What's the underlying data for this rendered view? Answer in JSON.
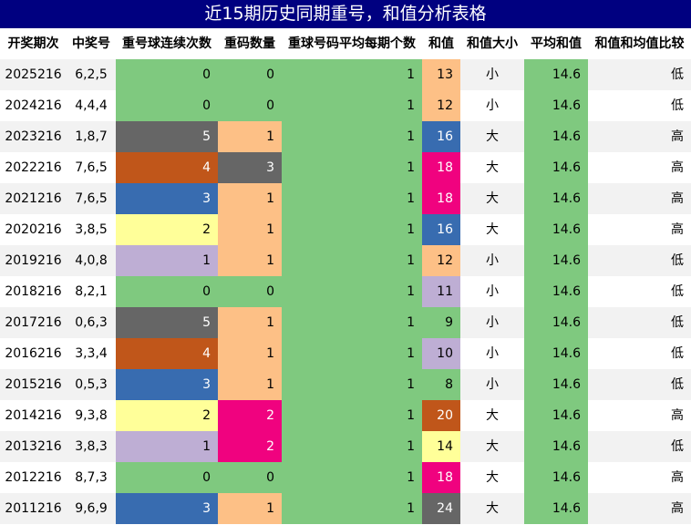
{
  "title": "近15期历史同期重号，和值分析表格",
  "headers": {
    "period": "开奖期次",
    "number": "中奖号",
    "consec": "重号球连续次数",
    "count": "重码数量",
    "avg": "重球号码平均每期个数",
    "sum": "和值",
    "size": "和值大小",
    "mean": "平均和值",
    "compare": "和值和均值比较"
  },
  "colors": {
    "green": "#7fc97f",
    "gray": "#666666",
    "orange_dark": "#c0561a",
    "blue": "#386cb0",
    "yellow": "#ffff99",
    "lavender": "#beaed4",
    "peach": "#fdc086",
    "magenta": "#f0027f",
    "row_alt": "#f2f2f2"
  },
  "rows": [
    {
      "period": "2025216",
      "number": "6,2,5",
      "consec": "0",
      "count": "0",
      "avg": "1",
      "sum": "13",
      "size": "小",
      "mean": "14.6",
      "compare": "低",
      "consec_color": "#7fc97f",
      "count_color": "#7fc97f",
      "sum_color": "#fdc086"
    },
    {
      "period": "2024216",
      "number": "4,4,4",
      "consec": "0",
      "count": "0",
      "avg": "1",
      "sum": "12",
      "size": "小",
      "mean": "14.6",
      "compare": "低",
      "consec_color": "#7fc97f",
      "count_color": "#7fc97f",
      "sum_color": "#fdc086"
    },
    {
      "period": "2023216",
      "number": "1,8,7",
      "consec": "5",
      "count": "1",
      "avg": "1",
      "sum": "16",
      "size": "大",
      "mean": "14.6",
      "compare": "高",
      "consec_color": "#666666",
      "count_color": "#fdc086",
      "sum_color": "#386cb0"
    },
    {
      "period": "2022216",
      "number": "7,6,5",
      "consec": "4",
      "count": "3",
      "avg": "1",
      "sum": "18",
      "size": "大",
      "mean": "14.6",
      "compare": "高",
      "consec_color": "#c0561a",
      "count_color": "#666666",
      "sum_color": "#f0027f"
    },
    {
      "period": "2021216",
      "number": "7,6,5",
      "consec": "3",
      "count": "1",
      "avg": "1",
      "sum": "18",
      "size": "大",
      "mean": "14.6",
      "compare": "高",
      "consec_color": "#386cb0",
      "count_color": "#fdc086",
      "sum_color": "#f0027f"
    },
    {
      "period": "2020216",
      "number": "3,8,5",
      "consec": "2",
      "count": "1",
      "avg": "1",
      "sum": "16",
      "size": "大",
      "mean": "14.6",
      "compare": "高",
      "consec_color": "#ffff99",
      "count_color": "#fdc086",
      "sum_color": "#386cb0"
    },
    {
      "period": "2019216",
      "number": "4,0,8",
      "consec": "1",
      "count": "1",
      "avg": "1",
      "sum": "12",
      "size": "小",
      "mean": "14.6",
      "compare": "低",
      "consec_color": "#beaed4",
      "count_color": "#fdc086",
      "sum_color": "#fdc086"
    },
    {
      "period": "2018216",
      "number": "8,2,1",
      "consec": "0",
      "count": "0",
      "avg": "1",
      "sum": "11",
      "size": "小",
      "mean": "14.6",
      "compare": "低",
      "consec_color": "#7fc97f",
      "count_color": "#7fc97f",
      "sum_color": "#beaed4"
    },
    {
      "period": "2017216",
      "number": "0,6,3",
      "consec": "5",
      "count": "1",
      "avg": "1",
      "sum": "9",
      "size": "小",
      "mean": "14.6",
      "compare": "低",
      "consec_color": "#666666",
      "count_color": "#fdc086",
      "sum_color": "#7fc97f"
    },
    {
      "period": "2016216",
      "number": "3,3,4",
      "consec": "4",
      "count": "1",
      "avg": "1",
      "sum": "10",
      "size": "小",
      "mean": "14.6",
      "compare": "低",
      "consec_color": "#c0561a",
      "count_color": "#fdc086",
      "sum_color": "#beaed4"
    },
    {
      "period": "2015216",
      "number": "0,5,3",
      "consec": "3",
      "count": "1",
      "avg": "1",
      "sum": "8",
      "size": "小",
      "mean": "14.6",
      "compare": "低",
      "consec_color": "#386cb0",
      "count_color": "#fdc086",
      "sum_color": "#7fc97f"
    },
    {
      "period": "2014216",
      "number": "9,3,8",
      "consec": "2",
      "count": "2",
      "avg": "1",
      "sum": "20",
      "size": "大",
      "mean": "14.6",
      "compare": "高",
      "consec_color": "#ffff99",
      "count_color": "#f0027f",
      "sum_color": "#c0561a"
    },
    {
      "period": "2013216",
      "number": "3,8,3",
      "consec": "1",
      "count": "2",
      "avg": "1",
      "sum": "14",
      "size": "大",
      "mean": "14.6",
      "compare": "低",
      "consec_color": "#beaed4",
      "count_color": "#f0027f",
      "sum_color": "#ffff99"
    },
    {
      "period": "2012216",
      "number": "8,7,3",
      "consec": "0",
      "count": "0",
      "avg": "1",
      "sum": "18",
      "size": "大",
      "mean": "14.6",
      "compare": "高",
      "consec_color": "#7fc97f",
      "count_color": "#7fc97f",
      "sum_color": "#f0027f"
    },
    {
      "period": "2011216",
      "number": "9,6,9",
      "consec": "3",
      "count": "1",
      "avg": "1",
      "sum": "24",
      "size": "大",
      "mean": "14.6",
      "compare": "高",
      "consec_color": "#386cb0",
      "count_color": "#fdc086",
      "sum_color": "#666666"
    }
  ]
}
